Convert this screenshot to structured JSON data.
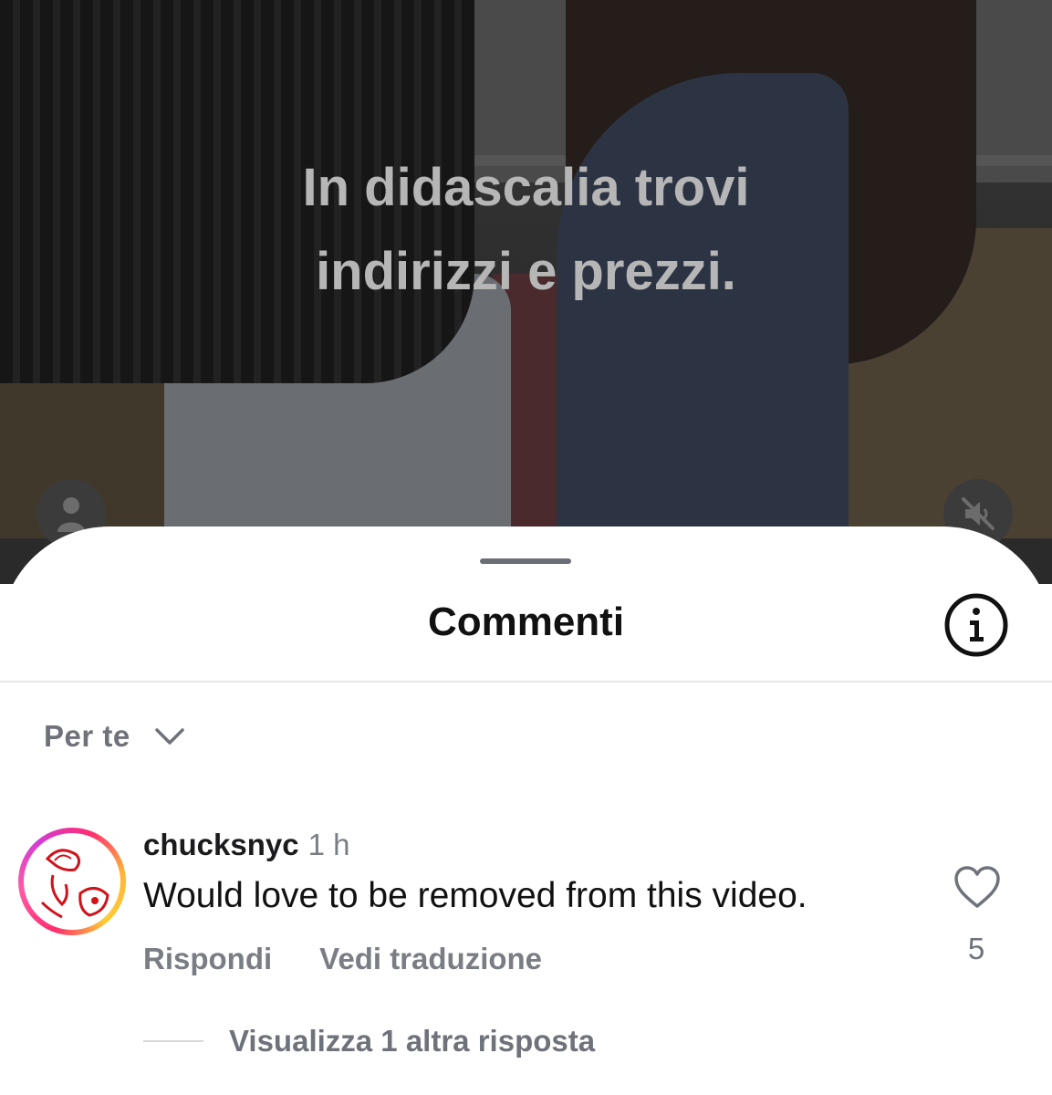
{
  "video": {
    "overlay_lines": [
      "In didascalia trovi",
      "indirizzi e prezzi."
    ],
    "user_icon": "user-icon",
    "mute_icon": "speaker-muted-icon"
  },
  "sheet": {
    "title": "Commenti",
    "info_icon": "info-icon",
    "sort_label": "Per te",
    "sort_icon": "chevron-down-icon"
  },
  "comment": {
    "username": "chucksnyc",
    "time": "1 h",
    "text": "Would love to be removed from this video.",
    "reply_label": "Rispondi",
    "translate_label": "Vedi traduzione",
    "like_icon": "heart-icon",
    "like_count": "5",
    "replies_label": "Visualizza 1 altra risposta"
  },
  "colors": {
    "accent_ring": "#ff2d6f",
    "text_primary": "#111111",
    "text_secondary": "#7a7d84"
  }
}
